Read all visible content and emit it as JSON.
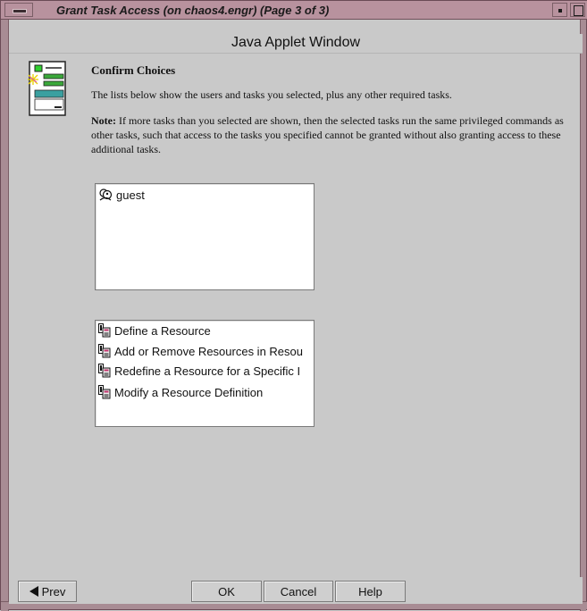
{
  "window": {
    "title": "Grant Task Access (on chaos4.engr) (Page 3 of 3)"
  },
  "applet": {
    "banner": "Java Applet Window"
  },
  "content": {
    "heading": "Confirm Choices",
    "description": "The lists below show the users and tasks you selected, plus any other required tasks.",
    "note_label": "Note:",
    "note_text": "If more tasks than you selected are shown, then the selected tasks run the same privileged commands as other tasks, such that access to the tasks you specified cannot be granted without also granting access to these additional tasks."
  },
  "users": [
    {
      "label": "guest",
      "icon": "user-group-icon"
    }
  ],
  "tasks": [
    {
      "label": "Define a Resource",
      "icon": "task-icon"
    },
    {
      "label": "Add or Remove Resources in Resou",
      "icon": "task-icon"
    },
    {
      "label": "Redefine a Resource for a Specific I",
      "icon": "task-icon"
    },
    {
      "label": "Modify a Resource Definition",
      "icon": "task-icon"
    }
  ],
  "buttons": {
    "prev": "Prev",
    "ok": "OK",
    "cancel": "Cancel",
    "help": "Help"
  }
}
